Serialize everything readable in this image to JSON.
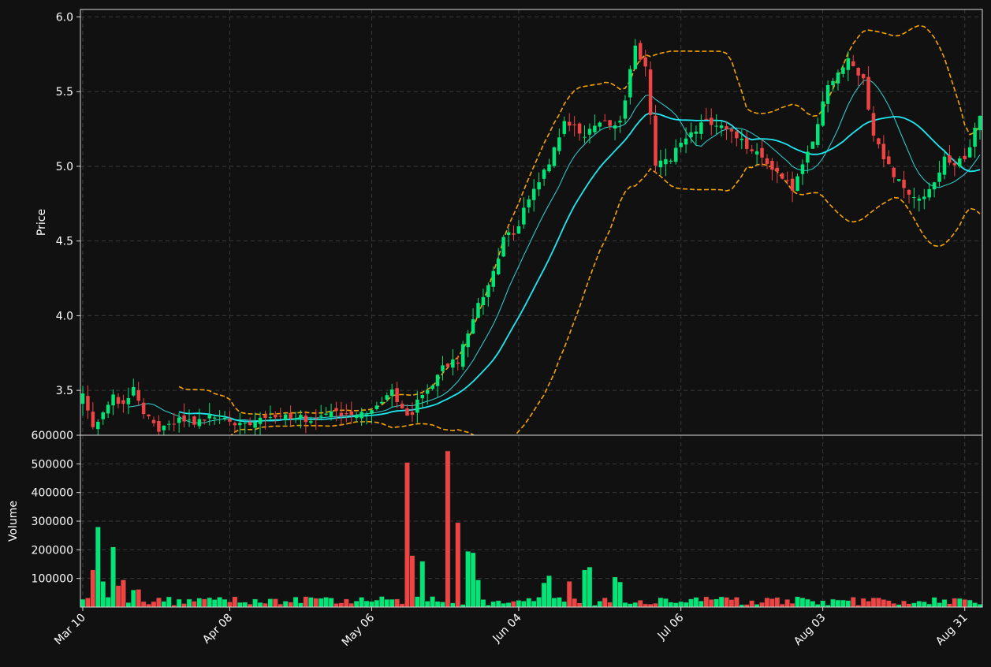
{
  "colors": {
    "background": "#111111",
    "axes": "#d9d9d9",
    "grid": "#3a3a3a",
    "up": "#00e676",
    "down": "#ef4444",
    "ma_fast": "#2fd6d6",
    "ma_slow": "#1ee8f0",
    "bands": "#f5a300",
    "text": "#ffffff"
  },
  "chart_data": {
    "type": "candlestick",
    "price_panel": {
      "ylabel": "Price",
      "ylim": [
        3.2,
        6.05
      ],
      "yticks": [
        3.5,
        4.0,
        4.5,
        5.0,
        5.5,
        6.0
      ],
      "ytick_labels": [
        "3.5",
        "4.0",
        "4.5",
        "5.0",
        "5.5",
        "6.0"
      ],
      "grid": true
    },
    "volume_panel": {
      "ylabel": "Volume",
      "ylim": [
        0,
        600000
      ],
      "yticks": [
        100000,
        200000,
        300000,
        400000,
        500000,
        600000
      ],
      "ytick_labels": [
        "100000",
        "200000",
        "300000",
        "400000",
        "500000",
        "600000"
      ],
      "grid": true
    },
    "x_axis": {
      "first_date": "2024-03-10",
      "last_date": "2024-09-03",
      "ticks": [
        "2024-03-10",
        "2024-04-08",
        "2024-05-06",
        "2024-06-04",
        "2024-07-06",
        "2024-08-03",
        "2024-08-31"
      ],
      "tick_labels": [
        "Mar 10",
        "Apr 08",
        "May 06",
        "Jun 04",
        "Jul 06",
        "Aug 03",
        "Aug 31"
      ]
    },
    "overlays": [
      {
        "kind": "moving-average",
        "window": 10
      },
      {
        "kind": "moving-average",
        "window": 20
      },
      {
        "kind": "bollinger-bands",
        "window": 20,
        "num_std": 2
      }
    ],
    "price_anchors": [
      [
        "2024-03-10",
        3.47
      ],
      [
        "2024-03-12",
        3.24
      ],
      [
        "2024-03-14",
        3.33
      ],
      [
        "2024-03-16",
        3.45
      ],
      [
        "2024-03-18",
        3.41
      ],
      [
        "2024-03-20",
        3.52
      ],
      [
        "2024-03-22",
        3.33
      ],
      [
        "2024-03-25",
        3.24
      ],
      [
        "2024-03-29",
        3.31
      ],
      [
        "2024-04-02",
        3.29
      ],
      [
        "2024-04-05",
        3.33
      ],
      [
        "2024-04-10",
        3.27
      ],
      [
        "2024-04-15",
        3.34
      ],
      [
        "2024-04-22",
        3.31
      ],
      [
        "2024-04-29",
        3.35
      ],
      [
        "2024-05-06",
        3.36
      ],
      [
        "2024-05-10",
        3.48
      ],
      [
        "2024-05-13",
        3.31
      ],
      [
        "2024-05-16",
        3.46
      ],
      [
        "2024-05-20",
        3.66
      ],
      [
        "2024-05-23",
        3.7
      ],
      [
        "2024-05-26",
        4.0
      ],
      [
        "2024-05-29",
        4.22
      ],
      [
        "2024-06-01",
        4.5
      ],
      [
        "2024-06-04",
        4.6
      ],
      [
        "2024-06-06",
        4.8
      ],
      [
        "2024-06-10",
        5.0
      ],
      [
        "2024-06-13",
        5.32
      ],
      [
        "2024-06-17",
        5.2
      ],
      [
        "2024-06-20",
        5.3
      ],
      [
        "2024-06-24",
        5.3
      ],
      [
        "2024-06-27",
        5.8
      ],
      [
        "2024-06-29",
        5.65
      ],
      [
        "2024-07-01",
        5.0
      ],
      [
        "2024-07-04",
        5.05
      ],
      [
        "2024-07-08",
        5.25
      ],
      [
        "2024-07-12",
        5.3
      ],
      [
        "2024-07-16",
        5.22
      ],
      [
        "2024-07-20",
        5.1
      ],
      [
        "2024-07-24",
        5.0
      ],
      [
        "2024-07-28",
        4.85
      ],
      [
        "2024-08-01",
        5.15
      ],
      [
        "2024-08-04",
        5.55
      ],
      [
        "2024-08-08",
        5.7
      ],
      [
        "2024-08-11",
        5.6
      ],
      [
        "2024-08-13",
        5.2
      ],
      [
        "2024-08-16",
        5.0
      ],
      [
        "2024-08-20",
        4.8
      ],
      [
        "2024-08-24",
        4.82
      ],
      [
        "2024-08-27",
        5.05
      ],
      [
        "2024-08-31",
        5.02
      ],
      [
        "2024-09-03",
        5.35
      ]
    ],
    "volume_spikes": [
      [
        "2024-03-12",
        130000
      ],
      [
        "2024-03-13",
        280000
      ],
      [
        "2024-03-14",
        90000
      ],
      [
        "2024-03-16",
        210000
      ],
      [
        "2024-03-17",
        75000
      ],
      [
        "2024-03-18",
        95000
      ],
      [
        "2024-03-20",
        60000
      ],
      [
        "2024-03-21",
        62000
      ],
      [
        "2024-05-13",
        505000
      ],
      [
        "2024-05-14",
        180000
      ],
      [
        "2024-05-16",
        160000
      ],
      [
        "2024-05-21",
        545000
      ],
      [
        "2024-05-23",
        295000
      ],
      [
        "2024-05-25",
        195000
      ],
      [
        "2024-05-26",
        190000
      ],
      [
        "2024-05-27",
        95000
      ],
      [
        "2024-06-09",
        85000
      ],
      [
        "2024-06-10",
        110000
      ],
      [
        "2024-06-14",
        90000
      ],
      [
        "2024-06-17",
        130000
      ],
      [
        "2024-06-18",
        140000
      ],
      [
        "2024-06-23",
        105000
      ],
      [
        "2024-06-24",
        88000
      ]
    ],
    "volume_base": 22000
  }
}
